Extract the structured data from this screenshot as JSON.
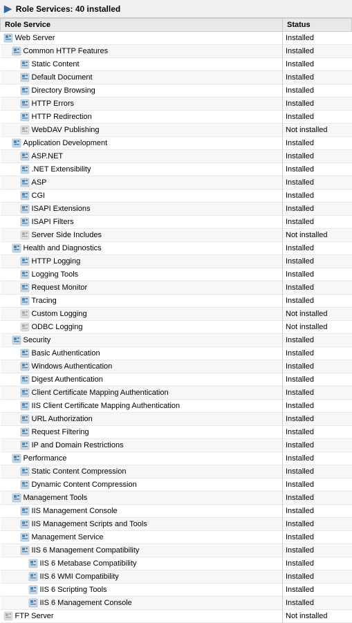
{
  "header": {
    "title": "Role Services:",
    "count": "40 installed"
  },
  "columns": {
    "roleService": "Role Service",
    "status": "Status"
  },
  "rows": [
    {
      "name": "Web Server",
      "indent": 0,
      "status": "Installed"
    },
    {
      "name": "Common HTTP Features",
      "indent": 1,
      "status": "Installed"
    },
    {
      "name": "Static Content",
      "indent": 2,
      "status": "Installed"
    },
    {
      "name": "Default Document",
      "indent": 2,
      "status": "Installed"
    },
    {
      "name": "Directory Browsing",
      "indent": 2,
      "status": "Installed"
    },
    {
      "name": "HTTP Errors",
      "indent": 2,
      "status": "Installed"
    },
    {
      "name": "HTTP Redirection",
      "indent": 2,
      "status": "Installed"
    },
    {
      "name": "WebDAV Publishing",
      "indent": 2,
      "status": "Not installed"
    },
    {
      "name": "Application Development",
      "indent": 1,
      "status": "Installed"
    },
    {
      "name": "ASP.NET",
      "indent": 2,
      "status": "Installed"
    },
    {
      "name": ".NET Extensibility",
      "indent": 2,
      "status": "Installed"
    },
    {
      "name": "ASP",
      "indent": 2,
      "status": "Installed"
    },
    {
      "name": "CGI",
      "indent": 2,
      "status": "Installed"
    },
    {
      "name": "ISAPI Extensions",
      "indent": 2,
      "status": "Installed"
    },
    {
      "name": "ISAPI Filters",
      "indent": 2,
      "status": "Installed"
    },
    {
      "name": "Server Side Includes",
      "indent": 2,
      "status": "Not installed"
    },
    {
      "name": "Health and Diagnostics",
      "indent": 1,
      "status": "Installed"
    },
    {
      "name": "HTTP Logging",
      "indent": 2,
      "status": "Installed"
    },
    {
      "name": "Logging Tools",
      "indent": 2,
      "status": "Installed"
    },
    {
      "name": "Request Monitor",
      "indent": 2,
      "status": "Installed"
    },
    {
      "name": "Tracing",
      "indent": 2,
      "status": "Installed"
    },
    {
      "name": "Custom Logging",
      "indent": 2,
      "status": "Not installed"
    },
    {
      "name": "ODBC Logging",
      "indent": 2,
      "status": "Not installed"
    },
    {
      "name": "Security",
      "indent": 1,
      "status": "Installed"
    },
    {
      "name": "Basic Authentication",
      "indent": 2,
      "status": "Installed"
    },
    {
      "name": "Windows Authentication",
      "indent": 2,
      "status": "Installed"
    },
    {
      "name": "Digest Authentication",
      "indent": 2,
      "status": "Installed"
    },
    {
      "name": "Client Certificate Mapping Authentication",
      "indent": 2,
      "status": "Installed"
    },
    {
      "name": "IIS Client Certificate Mapping Authentication",
      "indent": 2,
      "status": "Installed"
    },
    {
      "name": "URL Authorization",
      "indent": 2,
      "status": "Installed"
    },
    {
      "name": "Request Filtering",
      "indent": 2,
      "status": "Installed"
    },
    {
      "name": "IP and Domain Restrictions",
      "indent": 2,
      "status": "Installed"
    },
    {
      "name": "Performance",
      "indent": 1,
      "status": "Installed"
    },
    {
      "name": "Static Content Compression",
      "indent": 2,
      "status": "Installed"
    },
    {
      "name": "Dynamic Content Compression",
      "indent": 2,
      "status": "Installed"
    },
    {
      "name": "Management Tools",
      "indent": 1,
      "status": "Installed"
    },
    {
      "name": "IIS Management Console",
      "indent": 2,
      "status": "Installed"
    },
    {
      "name": "IIS Management Scripts and Tools",
      "indent": 2,
      "status": "Installed"
    },
    {
      "name": "Management Service",
      "indent": 2,
      "status": "Installed"
    },
    {
      "name": "IIS 6 Management Compatibility",
      "indent": 2,
      "status": "Installed"
    },
    {
      "name": "IIS 6 Metabase Compatibility",
      "indent": 3,
      "status": "Installed"
    },
    {
      "name": "IIS 6 WMI Compatibility",
      "indent": 3,
      "status": "Installed"
    },
    {
      "name": "IIS 6 Scripting Tools",
      "indent": 3,
      "status": "Installed"
    },
    {
      "name": "IIS 6 Management Console",
      "indent": 3,
      "status": "Installed"
    },
    {
      "name": "FTP Server",
      "indent": 0,
      "status": "Not installed"
    }
  ]
}
